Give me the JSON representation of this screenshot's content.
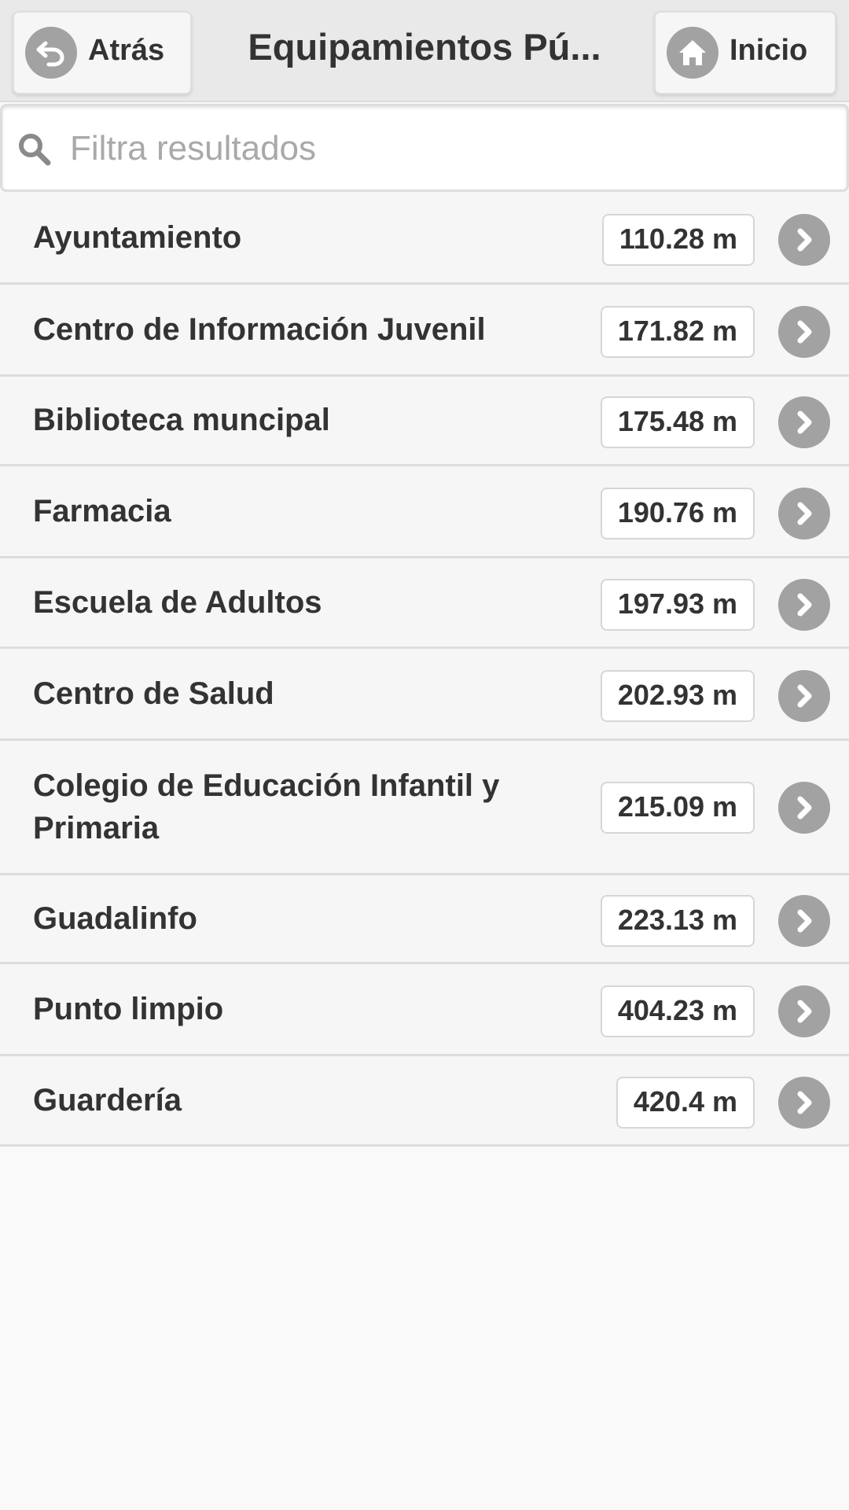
{
  "header": {
    "title": "Equipamientos Pú...",
    "back_label": "Atrás",
    "home_label": "Inicio"
  },
  "search": {
    "placeholder": "Filtra resultados",
    "value": ""
  },
  "items": [
    {
      "name": "Ayuntamiento",
      "distance": "110.28 m"
    },
    {
      "name": "Centro de Información Juvenil",
      "distance": "171.82 m"
    },
    {
      "name": "Biblioteca muncipal",
      "distance": "175.48 m"
    },
    {
      "name": "Farmacia",
      "distance": "190.76 m"
    },
    {
      "name": "Escuela de Adultos",
      "distance": "197.93 m"
    },
    {
      "name": "Centro de Salud",
      "distance": "202.93 m"
    },
    {
      "name": "Colegio de Educación Infantil y Primaria",
      "distance": "215.09 m"
    },
    {
      "name": "Guadalinfo",
      "distance": "223.13 m"
    },
    {
      "name": "Punto limpio",
      "distance": "404.23 m"
    },
    {
      "name": "Guardería",
      "distance": "420.4 m"
    }
  ],
  "icons": {
    "back": "back-arrow-icon",
    "home": "home-icon",
    "search": "search-icon",
    "row": "chevron-right-icon"
  },
  "colors": {
    "header_bg": "#e9e9e9",
    "row_bg": "#f6f6f6",
    "icon_gray": "#a2a2a2",
    "text": "#333333"
  }
}
